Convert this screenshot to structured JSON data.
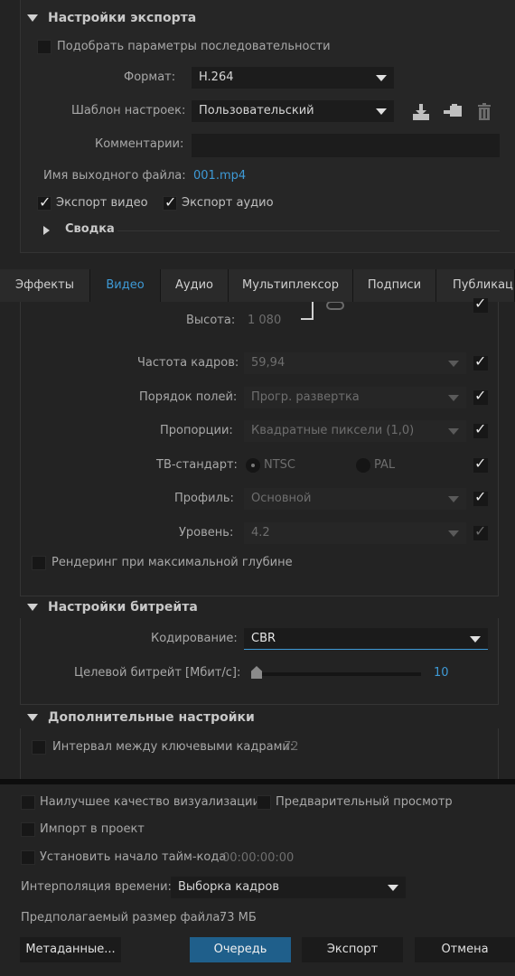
{
  "export_settings": {
    "title": "Настройки экспорта",
    "match_sequence_label": "Подобрать параметры последовательности",
    "format_label": "Формат:",
    "format_value": "H.264",
    "preset_label": "Шаблон настроек:",
    "preset_value": "Пользовательский",
    "comments_label": "Комментарии:",
    "comments_value": "",
    "output_name_label": "Имя выходного файла:",
    "output_name_value": "001.mp4",
    "export_video_label": "Экспорт видео",
    "export_audio_label": "Экспорт аудио",
    "summary_label": "Сводка"
  },
  "tabs": [
    {
      "label": "Эффекты"
    },
    {
      "label": "Видео"
    },
    {
      "label": "Аудио"
    },
    {
      "label": "Мультиплексор"
    },
    {
      "label": "Подписи"
    },
    {
      "label": "Публикация"
    }
  ],
  "video": {
    "height_label": "Высота:",
    "height_value": "1 080",
    "frame_rate_label": "Частота кадров:",
    "frame_rate_value": "59,94",
    "field_order_label": "Порядок полей:",
    "field_order_value": "Прогр. развертка",
    "aspect_label": "Пропорции:",
    "aspect_value": "Квадратные пиксели (1,0)",
    "tv_standard_label": "ТВ-стандарт:",
    "tv_ntsc": "NTSC",
    "tv_pal": "PAL",
    "profile_label": "Профиль:",
    "profile_value": "Основной",
    "level_label": "Уровень:",
    "level_value": "4.2",
    "max_depth_label": "Рендеринг при максимальной глубине"
  },
  "bitrate": {
    "title": "Настройки битрейта",
    "encoding_label": "Кодирование:",
    "encoding_value": "CBR",
    "target_label": "Целевой битрейт [Мбит/с]:",
    "target_value": "10",
    "slider_fraction": 0.0
  },
  "advanced": {
    "title": "Дополнительные настройки",
    "keyframe_label": "Интервал между ключевыми кадрами:",
    "keyframe_value": "72"
  },
  "bottom": {
    "best_quality_label": "Наилучшее качество визуализации",
    "preview_label": "Предварительный просмотр",
    "import_label": "Импорт в проект",
    "timecode_label": "Установить начало тайм-кода",
    "timecode_value": "00:00:00:00",
    "interp_label": "Интерполяция времени:",
    "interp_value": "Выборка кадров",
    "file_size_label": "Предполагаемый размер файла:",
    "file_size_value": "73 МБ",
    "metadata_button": "Метаданные...",
    "queue_button": "Очередь",
    "export_button": "Экспорт",
    "cancel_button": "Отмена"
  },
  "colors": {
    "accent": "#3e9ad6",
    "primary_button": "#1f5f8b",
    "background": "#232323"
  },
  "icons": [
    "save-preset-icon",
    "import-preset-icon",
    "delete-preset-icon",
    "link-icon"
  ]
}
